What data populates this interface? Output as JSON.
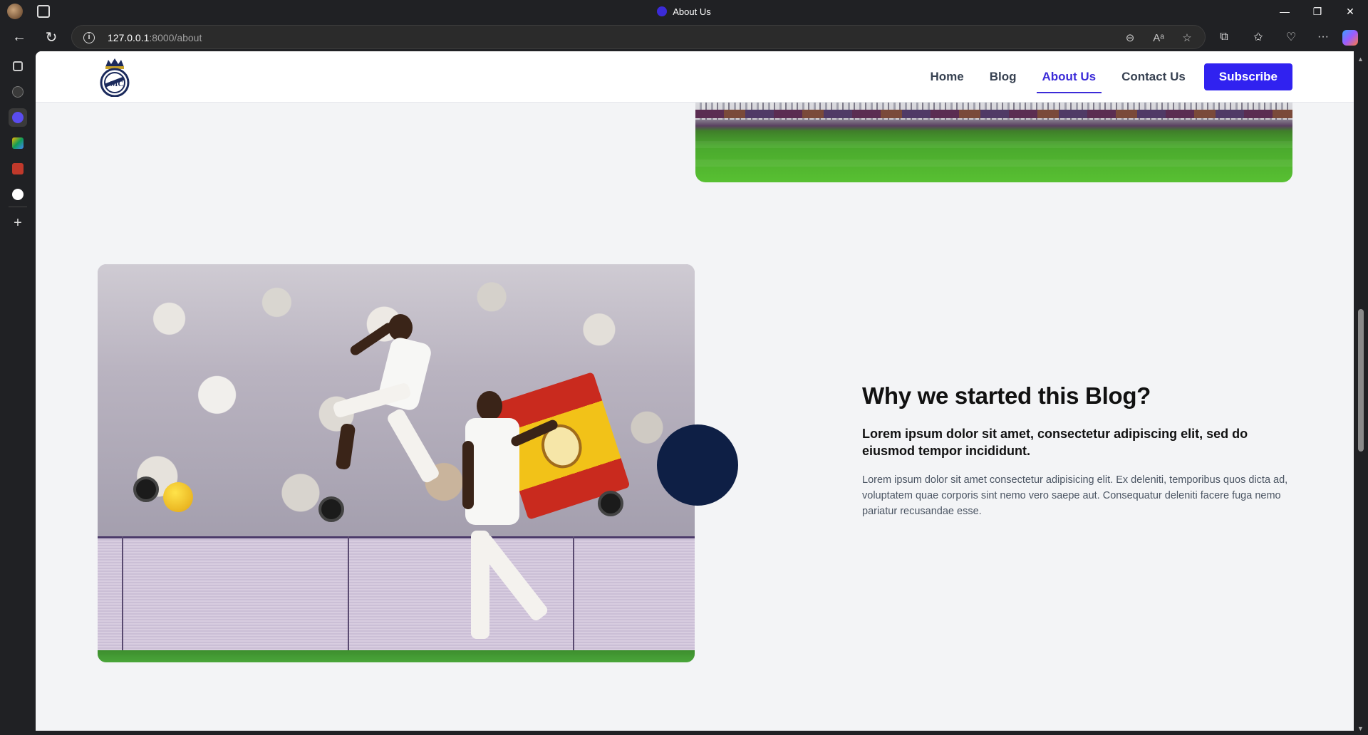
{
  "browser": {
    "tab_title": "About Us",
    "url_host": "127.0.0.1",
    "url_path": ":8000/about",
    "window_controls": {
      "minimize": "—",
      "restore": "❐",
      "close": "✕"
    }
  },
  "toolbar_icons": [
    "zoom-out-icon",
    "read-aloud-icon",
    "favorite-icon",
    "extensions-icon",
    "favorites-icon",
    "browser-essentials-icon",
    "more-icon",
    "copilot-icon"
  ],
  "header": {
    "nav": [
      {
        "label": "Home",
        "active": false
      },
      {
        "label": "Blog",
        "active": false
      },
      {
        "label": "About Us",
        "active": true
      },
      {
        "label": "Contact Us",
        "active": false
      }
    ],
    "subscribe_label": "Subscribe"
  },
  "feature": {
    "title": "Why we started this Blog?",
    "subtitle": "Lorem ipsum dolor sit amet, consectetur adipiscing elit, sed do eiusmod tempor incididunt.",
    "body": "Lorem ipsum dolor sit amet consectetur adipisicing elit. Ex deleniti, temporibus quos dicta ad, voluptatem quae corporis sint nemo vero saepe aut. Consequatur deleniti facere fuga nemo pariatur recusandae esse."
  },
  "colors": {
    "accent": "#3022f0",
    "active_nav": "#3b2bd8",
    "navy_circle": "#0e1f45",
    "page_bg": "#f3f4f6"
  }
}
